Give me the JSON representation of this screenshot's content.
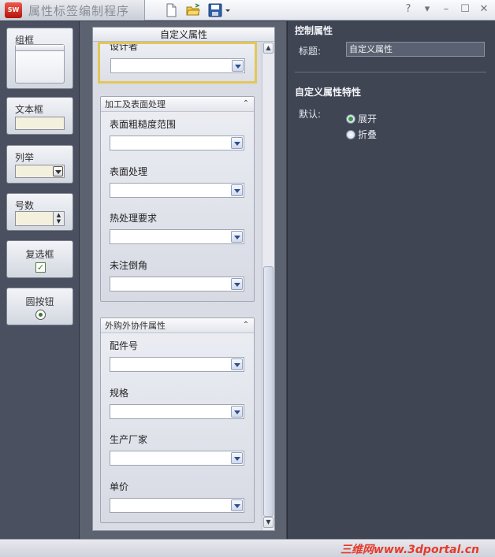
{
  "window": {
    "title": "属性标签编制程序",
    "logo_text": "SW",
    "controls": [
      "?",
      "▾",
      "–",
      "☐",
      "✕"
    ]
  },
  "toolbox": {
    "items": [
      {
        "label": "组框"
      },
      {
        "label": "文本框"
      },
      {
        "label": "列举"
      },
      {
        "label": "号数"
      },
      {
        "label": "复选框"
      },
      {
        "label": "圆按钮"
      }
    ]
  },
  "form": {
    "header": "自定义属性",
    "top_group": {
      "label": "设计者"
    },
    "groups": [
      {
        "title": "加工及表面处理",
        "fields": [
          {
            "label": "表面粗糙度范围"
          },
          {
            "label": "表面处理"
          },
          {
            "label": "热处理要求"
          },
          {
            "label": "未注倒角"
          }
        ]
      },
      {
        "title": "外购外协件属性",
        "fields": [
          {
            "label": "配件号"
          },
          {
            "label": "规格"
          },
          {
            "label": "生产厂家"
          },
          {
            "label": "单价"
          }
        ]
      }
    ]
  },
  "properties": {
    "control_section": "控制属性",
    "title_label": "标题:",
    "title_value": "自定义属性",
    "custom_section": "自定义属性特性",
    "default_label": "默认:",
    "options": [
      {
        "label": "展开",
        "selected": true
      },
      {
        "label": "折叠",
        "selected": false
      }
    ]
  },
  "status": {
    "watermark": "三维网www.3dportal.cn"
  }
}
